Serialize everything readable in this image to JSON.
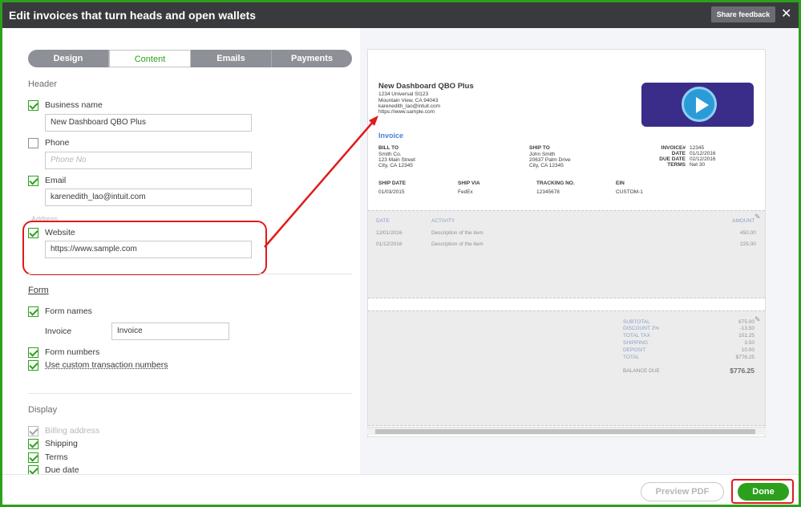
{
  "titlebar": {
    "title": "Edit invoices that turn heads and open wallets",
    "share": "Share feedback",
    "close": "✕"
  },
  "tabs": [
    "Design",
    "Content",
    "Emails",
    "Payments"
  ],
  "header": {
    "heading": "Header",
    "business_name": {
      "label": "Business name",
      "value": "New Dashboard QBO Plus"
    },
    "phone": {
      "label": "Phone",
      "placeholder": "Phone No"
    },
    "email": {
      "label": "Email",
      "value": "karenedith_lao@intuit.com"
    },
    "address_label": "Address",
    "website": {
      "label": "Website",
      "value": "https://www.sample.com"
    }
  },
  "form": {
    "heading": "Form",
    "form_names": "Form names",
    "invoice_label": "Invoice",
    "invoice_value": "Invoice",
    "form_numbers": "Form numbers",
    "custom_numbers": "Use custom transaction numbers"
  },
  "display": {
    "heading": "Display",
    "billing_address": "Billing address",
    "shipping": "Shipping",
    "terms": "Terms",
    "due_date": "Due date"
  },
  "footer": {
    "preview": "Preview PDF",
    "done": "Done"
  },
  "invoice": {
    "company": "New Dashboard QBO Plus",
    "addr1": "1234 Universal St123",
    "addr2": "Mountain View, CA 94043",
    "email": "karenedith_lao@intuit.com",
    "web": "https://www.sample.com",
    "title": "Invoice",
    "bill_to_h": "BILL TO",
    "bill_to_1": "Smith Co.",
    "bill_to_2": "123 Main Street",
    "bill_to_3": "City, CA 12345",
    "ship_to_h": "SHIP TO",
    "ship_to_1": "John Smith",
    "ship_to_2": "20637 Palm Drive",
    "ship_to_3": "City, CA 12345",
    "meta_labels": [
      "INVOICE#",
      "DATE",
      "DUE DATE",
      "TERMS"
    ],
    "meta_values": [
      "12345",
      "01/12/2016",
      "02/12/2016",
      "Net 30"
    ],
    "ship_date_h": "SHIP DATE",
    "ship_date": "01/03/2015",
    "ship_via_h": "SHIP VIA",
    "ship_via": "FedEx",
    "tracking_h": "TRACKING NO.",
    "tracking": "12345678",
    "ein_h": "EIN",
    "ein": "CUSTOM-1",
    "cols": [
      "DATE",
      "ACTIVITY",
      "AMOUNT"
    ],
    "rows": [
      {
        "date": "12/01/2016",
        "activity": "Description of the item",
        "amount": "450.00"
      },
      {
        "date": "01/12/2016",
        "activity": "Description of the item",
        "amount": "225.00"
      }
    ],
    "totals_labels": [
      "SUBTOTAL",
      "DISCOUNT 2%",
      "TOTAL TAX",
      "SHIPPING",
      "DEPOSIT",
      "TOTAL"
    ],
    "totals_values": [
      "675.00",
      "-13.50",
      "101.25",
      "3.50",
      "10.00",
      "$776.25"
    ],
    "balance_label": "BALANCE DUE",
    "balance_value": "$776.25"
  },
  "colors": {
    "brand_green": "#2ca01c",
    "annotation_red": "#e01b1b",
    "titlebar": "#393a3d"
  }
}
